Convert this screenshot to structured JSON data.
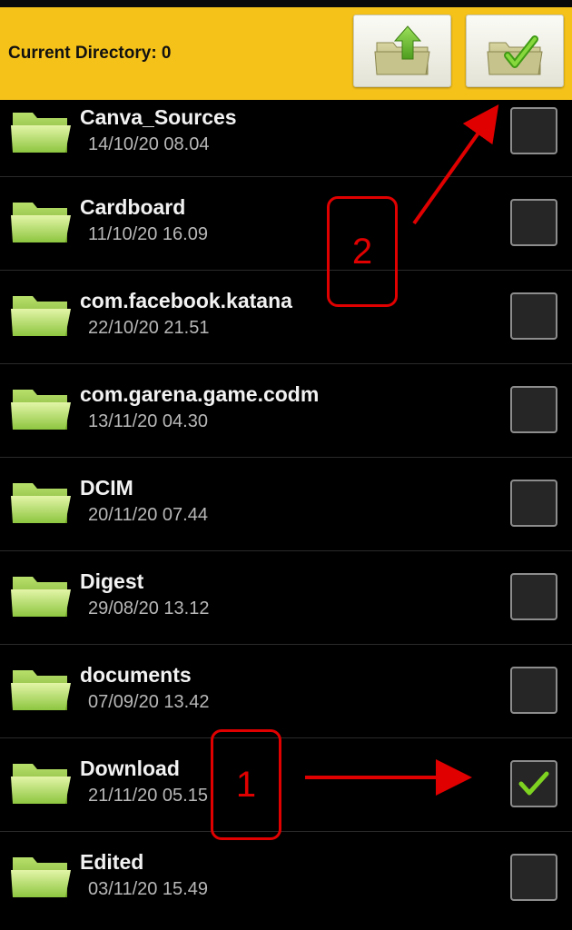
{
  "header": {
    "title": "Current Directory: 0",
    "buttons": {
      "up": "folder-up-icon",
      "select": "folder-check-icon"
    }
  },
  "colors": {
    "header_bg": "#f5c21a",
    "list_bg": "#000000",
    "folder_green": "#8dc63f",
    "check_green": "#7ed321",
    "annotation_red": "#e00000"
  },
  "folders": [
    {
      "name": "Canva_Sources",
      "date": "14/10/20 08.04",
      "checked": false
    },
    {
      "name": "Cardboard",
      "date": "11/10/20 16.09",
      "checked": false
    },
    {
      "name": "com.facebook.katana",
      "date": "22/10/20 21.51",
      "checked": false
    },
    {
      "name": "com.garena.game.codm",
      "date": "13/11/20 04.30",
      "checked": false
    },
    {
      "name": "DCIM",
      "date": "20/11/20 07.44",
      "checked": false
    },
    {
      "name": "Digest",
      "date": "29/08/20 13.12",
      "checked": false
    },
    {
      "name": "documents",
      "date": "07/09/20 13.42",
      "checked": false
    },
    {
      "name": "Download",
      "date": "21/11/20 05.15",
      "checked": true
    },
    {
      "name": "Edited",
      "date": "03/11/20 15.49",
      "checked": false
    }
  ],
  "annotations": {
    "step1": "1",
    "step2": "2"
  }
}
